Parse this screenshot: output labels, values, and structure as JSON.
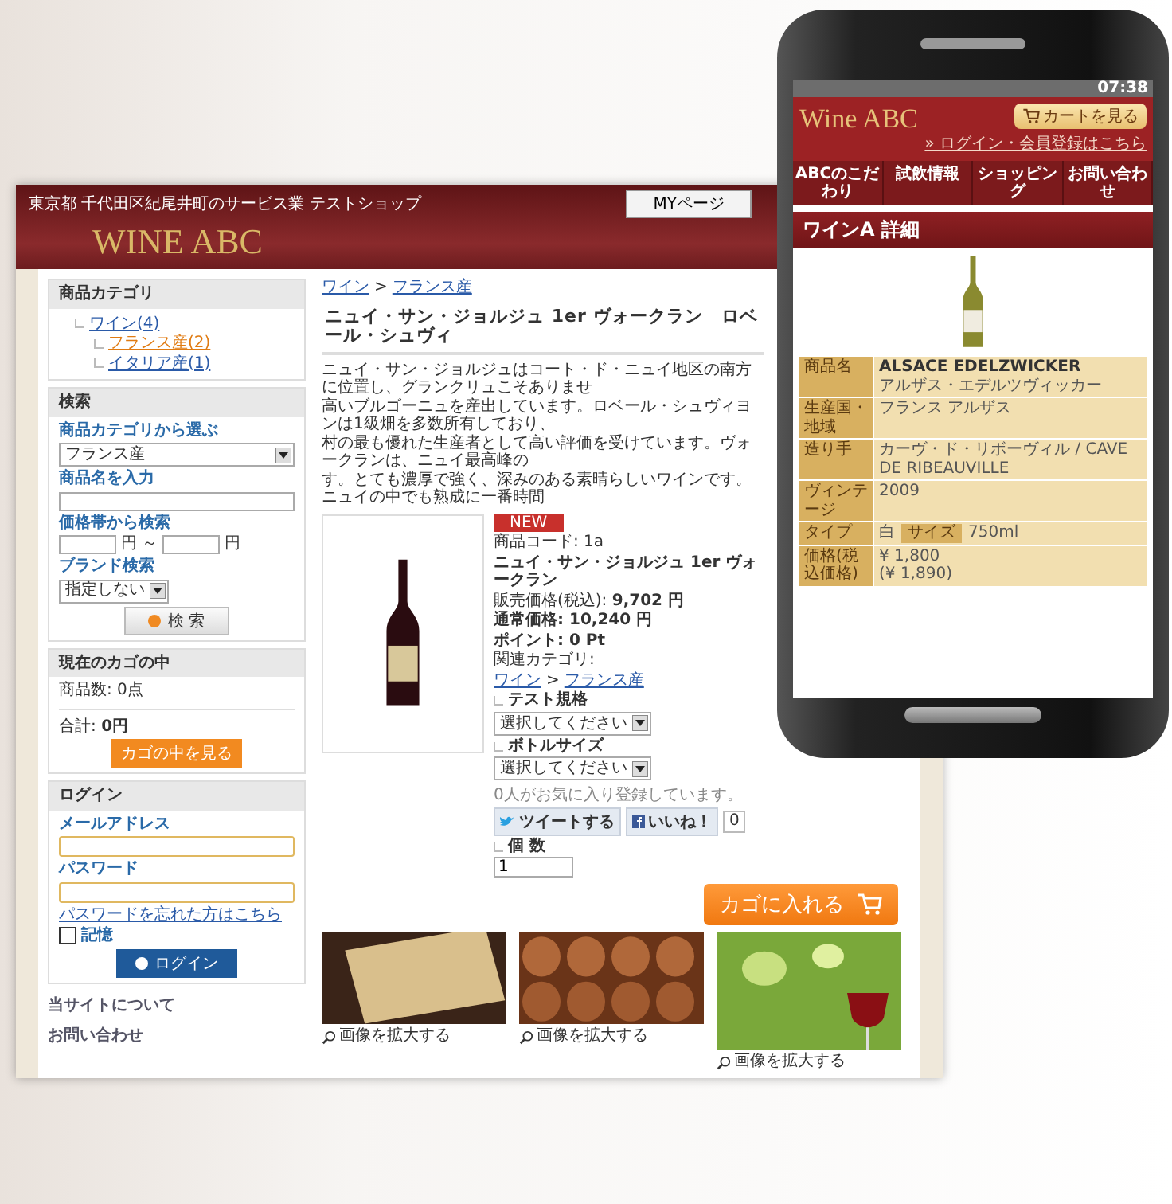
{
  "site": {
    "tagline": "東京都 千代田区紀尾井町のサービス業 テストショップ",
    "mypage_button": "MYページ",
    "logo": "WINE ABC"
  },
  "sidebar": {
    "category": {
      "title": "商品カテゴリ",
      "items": [
        {
          "label": "ワイン(4)",
          "selected": false,
          "children": [
            {
              "label": "フランス産(2)",
              "selected": true
            },
            {
              "label": "イタリア産(1)",
              "selected": false
            }
          ]
        }
      ]
    },
    "search": {
      "title": "検索",
      "category_label": "商品カテゴリから選ぶ",
      "category_value": "フランス産",
      "name_label": "商品名を入力",
      "price_label": "価格帯から検索",
      "price_from_unit": "円 ～",
      "price_to_unit": "円",
      "brand_label": "ブランド検索",
      "brand_value": "指定しない",
      "button": "検 索"
    },
    "cart": {
      "title": "現在のカゴの中",
      "count": "商品数: 0点",
      "total": "合計: **0円**",
      "button": "カゴの中を見る"
    },
    "login": {
      "title": "ログイン",
      "email_label": "メールアドレス",
      "password_label": "パスワード",
      "forgot_link": "パスワードを忘れた方はこちら",
      "remember": {
        "label": "記憶",
        "checked": false
      },
      "button": "ログイン"
    },
    "links": [
      "当サイトについて",
      "お問い合わせ"
    ]
  },
  "product": {
    "breadcrumb": [
      "ワイン",
      "フランス産"
    ],
    "separator": ">",
    "title": "ニュイ・サン・ジョルジュ 1er ヴォークラン　ロベール・シュヴィ",
    "description": [
      "ニュイ・サン・ジョルジュはコート・ド・ニュイ地区の南方に位置し、グランクリュこそありませ",
      "高いブルゴーニュを産出しています。ロベール・シュヴィヨンは1級畑を多数所有しており、",
      "村の最も優れた生産者として高い評価を受けています。ヴォークランは、ニュイ最高峰の",
      "す。とても濃厚で強く、深みのある素晴らしいワインです。ニュイの中でも熟成に一番時間"
    ],
    "info": [
      {
        "kind": "badge",
        "text": "NEW"
      },
      {
        "kind": "plain",
        "text": "商品コード: 1a"
      },
      {
        "kind": "bold",
        "text": "ニュイ・サン・ジョルジュ 1er ヴォークラン"
      },
      {
        "kind": "rich",
        "text": "販売価格(税込): **9,702 円**"
      },
      {
        "kind": "bold",
        "text": "通常価格: 10,240 円"
      },
      {
        "kind": "bold",
        "text": "ポイント: 0 Pt"
      },
      {
        "kind": "plain",
        "text": "関連カテゴリ:"
      }
    ],
    "related": [
      "ワイン",
      "フランス産"
    ],
    "options": [
      {
        "label": "テスト規格",
        "value": "選択してください"
      },
      {
        "label": "ボトルサイズ",
        "value": "選択してください"
      }
    ],
    "favorites": "0人がお気に入り登録しています。",
    "tweet": "ツイートする",
    "like": "いいね！",
    "like_count": "0",
    "quantity_label": "個 数",
    "quantity": "1",
    "add_to_cart": "カゴに入れる",
    "gallery": [
      {
        "kind": "label",
        "caption": "画像を拡大する"
      },
      {
        "kind": "barrels",
        "caption": "画像を拡大する"
      },
      {
        "kind": "glass",
        "caption": "画像を拡大する"
      }
    ]
  },
  "phone": {
    "time": "07:38",
    "logo": "Wine ABC",
    "cart_button": "カートを見る",
    "login_link": "» ログイン・会員登録はこちら",
    "nav": [
      "ABCのこだわり",
      "試飲情報",
      "ショッピング",
      "お問い合わせ"
    ],
    "title": "ワインA 詳細",
    "rows": [
      {
        "label": "商品名",
        "value": "ALSACE EDELZWICKER",
        "sub": "アルザス・エデルツヴィッカー"
      },
      {
        "label": "生産国・地域",
        "value": "フランス アルザス"
      },
      {
        "label": "造り手",
        "value": "カーヴ・ド・リボーヴィル / CAVE DE RIBEAUVILLE"
      },
      {
        "label": "ヴィンテージ",
        "value": "2009"
      },
      {
        "label": "タイプ",
        "value": "白",
        "extra_label": "サイズ",
        "extra_value": "750ml"
      },
      {
        "label": "価格(税込価格)",
        "value": "¥ 1,800",
        "sub": "(¥ 1,890)"
      }
    ]
  }
}
